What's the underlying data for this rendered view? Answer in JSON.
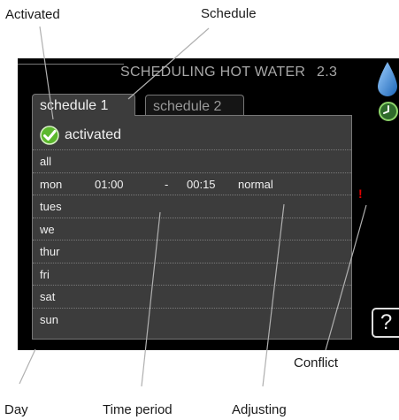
{
  "callouts": {
    "activated": "Activated",
    "schedule": "Schedule",
    "conflict": "Conflict",
    "day": "Day",
    "time_period": "Time period",
    "adjusting": "Adjusting"
  },
  "screen": {
    "title": "SCHEDULING HOT WATER",
    "menu_number": "2.3",
    "tabs": [
      {
        "label": "schedule 1",
        "active": true
      },
      {
        "label": "schedule 2",
        "active": false
      }
    ],
    "activated_label": "activated",
    "rows": [
      {
        "day": "all",
        "start": "",
        "dash": "",
        "end": "",
        "mode": ""
      },
      {
        "day": "mon",
        "start": "01:00",
        "dash": "-",
        "end": "00:15",
        "mode": "normal"
      },
      {
        "day": "tues",
        "start": "",
        "dash": "",
        "end": "",
        "mode": ""
      },
      {
        "day": "we",
        "start": "",
        "dash": "",
        "end": "",
        "mode": ""
      },
      {
        "day": "thur",
        "start": "",
        "dash": "",
        "end": "",
        "mode": ""
      },
      {
        "day": "fri",
        "start": "",
        "dash": "",
        "end": "",
        "mode": ""
      },
      {
        "day": "sat",
        "start": "",
        "dash": "",
        "end": "",
        "mode": ""
      },
      {
        "day": "sun",
        "start": "",
        "dash": "",
        "end": "",
        "mode": ""
      }
    ],
    "conflict_symbol": "!",
    "help_symbol": "?",
    "icons": [
      "water-drop-icon",
      "clock-icon",
      "checkmark-icon",
      "help-icon"
    ],
    "colors": {
      "screen_bg": "#000000",
      "panel_bg": "#3c3c3c",
      "check_green": "#5cb82e",
      "drop_blue": "#2a7fd0",
      "conflict_red": "#e00000"
    }
  }
}
